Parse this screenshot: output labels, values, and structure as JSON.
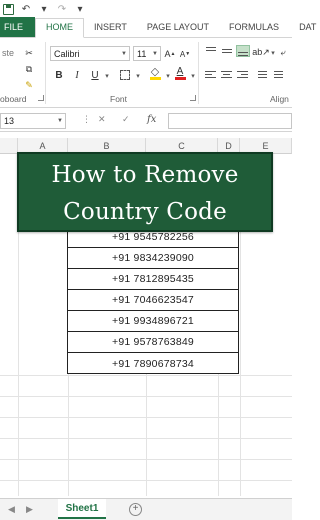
{
  "ribbon_tabs": {
    "file": "FILE",
    "home": "HOME",
    "insert": "INSERT",
    "page_layout": "PAGE LAYOUT",
    "formulas": "FORMULAS",
    "data": "DAT"
  },
  "ribbon": {
    "font_name": "Calibri",
    "font_size": "11",
    "clipboard_partial_label": "oboard",
    "paste_partial_label": "ste",
    "font_group_label": "Font",
    "alignment_partial_label": "Align",
    "bold": "B",
    "italic": "I",
    "underline": "U",
    "font_color_letter": "A",
    "accent_color": "#217346",
    "font_color_bar": "#e02020",
    "fill_color_bar": "#ffd800"
  },
  "formula_bar": {
    "name_box": "13",
    "fx": "fx",
    "cancel": "✕",
    "enter": "✓"
  },
  "columns": [
    "A",
    "B",
    "C",
    "D",
    "E"
  ],
  "banner": {
    "line1": "How to Remove",
    "line2": "Country Code",
    "background": "#1f5c38"
  },
  "phone_numbers": [
    "+91 9545782256",
    "+91 9834239090",
    "+91 7812895435",
    "+91 7046623547",
    "+91 9934896721",
    "+91 9578763849",
    "+91 7890678734"
  ],
  "sheet_tabs": {
    "active": "Sheet1",
    "add": "+"
  }
}
